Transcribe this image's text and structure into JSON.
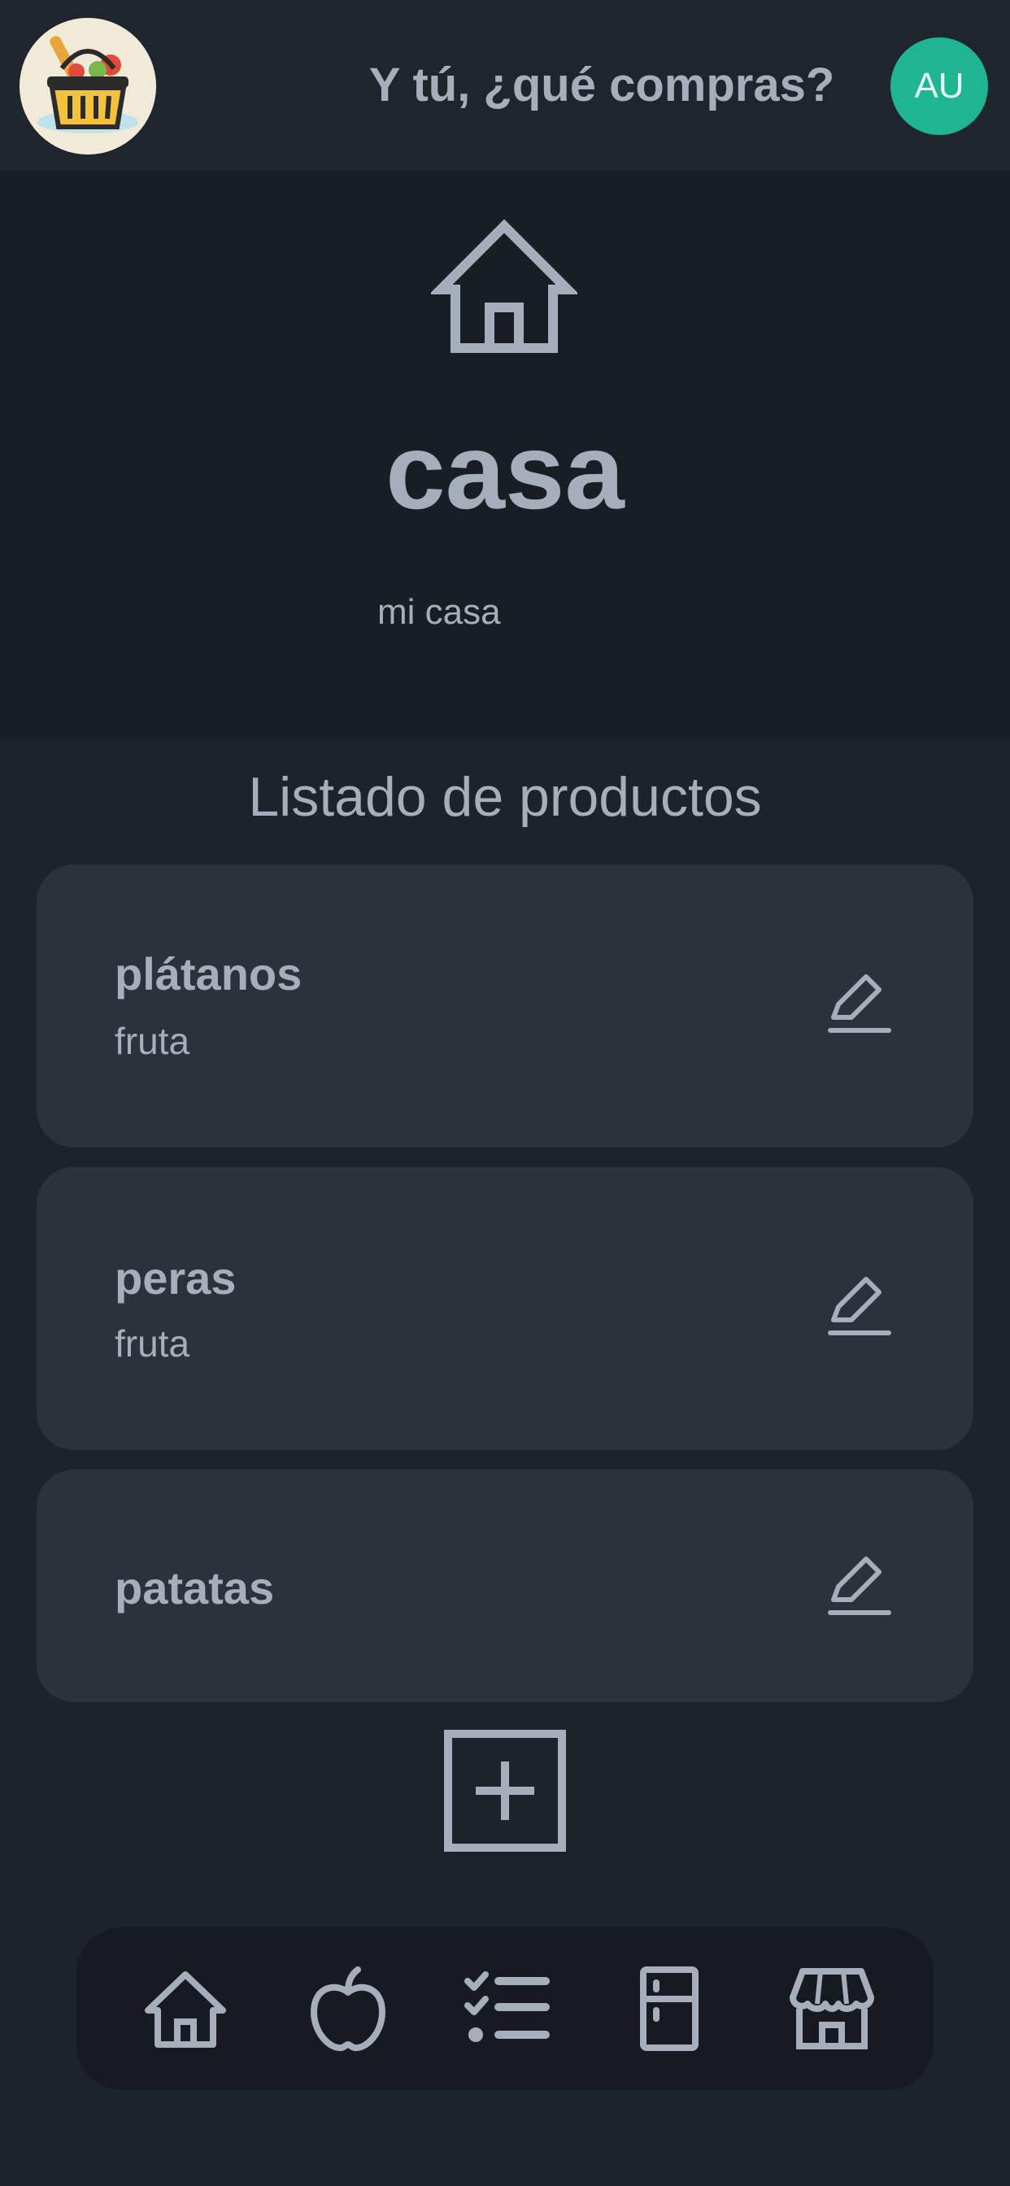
{
  "header": {
    "logo_icon": "shopping-basket-logo",
    "title": "Y tú, ¿qué compras?",
    "avatar_initials": "AU",
    "avatar_color": "#1fb592"
  },
  "list": {
    "icon": "house-icon",
    "name": "casa",
    "description": "mi casa"
  },
  "products_section": {
    "heading": "Listado de productos",
    "items": [
      {
        "name": "plátanos",
        "category": "fruta",
        "action_icon": "edit-icon"
      },
      {
        "name": "peras",
        "category": "fruta",
        "action_icon": "edit-icon"
      },
      {
        "name": "patatas",
        "category": "",
        "action_icon": "edit-icon"
      }
    ],
    "add_icon": "add-square-icon"
  },
  "bottom_nav": {
    "items": [
      {
        "icon": "home-icon"
      },
      {
        "icon": "apple-icon"
      },
      {
        "icon": "checklist-icon"
      },
      {
        "icon": "fridge-icon"
      },
      {
        "icon": "store-icon"
      }
    ]
  },
  "colors": {
    "background": "#1d232a",
    "card": "#2a323c",
    "text": "#a6adbb",
    "accent": "#1fb592"
  }
}
